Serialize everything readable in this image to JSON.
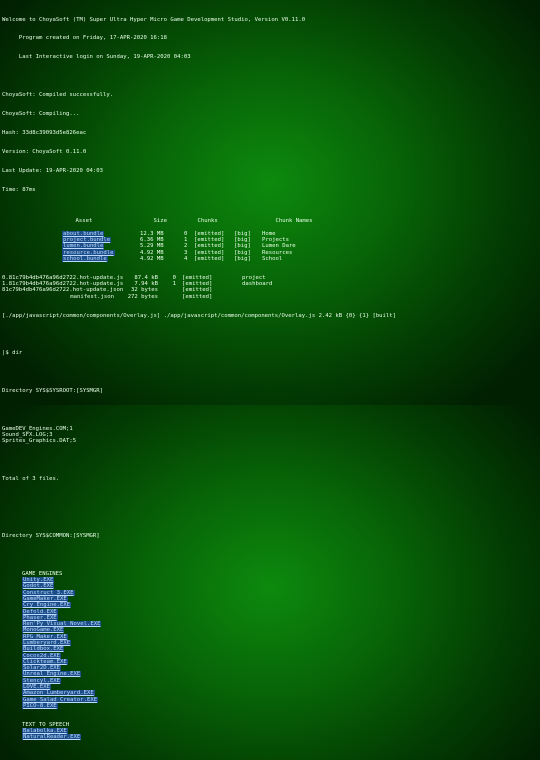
{
  "terminal": {
    "banner": [
      "Welcome to ChoyaSoft (TM) Super Ultra Hyper Micro Game Development Studio, Version V0.11.0",
      "     Program created on Friday, 17-APR-2020 16:18",
      "     Last Interactive login on Sunday, 19-APR-2020 04:03"
    ],
    "compile": [
      "ChoyaSoft: Compiled successfully.",
      "ChoyaSoft: Compiling...",
      "Hash: 33d8c39093d5e826eac",
      "Version: ChoyaSoft 0.11.0",
      "Last Update: 19-APR-2020 04:03",
      "Time: 87ms"
    ],
    "asset_headers": [
      "Asset",
      "Size",
      "Chunks",
      "",
      "",
      "Chunk Names"
    ],
    "assets": [
      {
        "name": "about.bundle",
        "size": "12.3 MB",
        "chunk": "0",
        "status": "[emitted]",
        "flag": "[big]",
        "chunk_name": "Home"
      },
      {
        "name": "project.bundle",
        "size": "6.36 MB",
        "chunk": "1",
        "status": "[emitted]",
        "flag": "[big]",
        "chunk_name": "Projects"
      },
      {
        "name": "lumen.bundle",
        "size": "5.29 MB",
        "chunk": "2",
        "status": "[emitted]",
        "flag": "[big]",
        "chunk_name": "Lumen Dare"
      },
      {
        "name": "resource.bundle",
        "size": "4.92 MB",
        "chunk": "3",
        "status": "[emitted]",
        "flag": "[big]",
        "chunk_name": "Resources"
      },
      {
        "name": "school.bundle",
        "size": "4.92 MB",
        "chunk": "4",
        "status": "[emitted]",
        "flag": "[big]",
        "chunk_name": "School"
      }
    ],
    "hot_updates": [
      {
        "file": "0.81c79b4db476a96d2722.hot-update.js",
        "size": "87.4 kB",
        "chunk": "0",
        "status": "[emitted]",
        "name": "project"
      },
      {
        "file": "1.81c79b4db476a96d2722.hot-update.js",
        "size": "7.94 kB",
        "chunk": "1",
        "status": "[emitted]",
        "name": "dashboard"
      },
      {
        "file": "81c79b4db476a96d2722.hot-update.json",
        "size": "32 bytes",
        "chunk": "",
        "status": "[emitted]",
        "name": ""
      },
      {
        "file": "manifest.json",
        "size": "272 bytes",
        "chunk": "",
        "status": "[emitted]",
        "name": ""
      }
    ],
    "overlay_line": "[./app/javascript/common/components/Overlay.js] ./app/javascript/common/components/Overlay.js 2.42 kB {0} {1} [built]",
    "cmd": "|$ dir",
    "dir_root": "Directory SYS$SYSROOT:[SYSMGR]",
    "root_files": [
      "GameDEV_Engines.COM;1",
      "Sound_SFX.LOG;3",
      "Sprites_Graphics.DAT;5"
    ],
    "total": "Total of 3 files.",
    "dir_common": "Directory SYS$COMMON:[SYSMGR]",
    "sections": [
      {
        "title": "GAME ENGINES",
        "items": [
          "Unity.EXE",
          "Godot.EXE",
          "Construct 3.EXE",
          "GameMaker.EXE",
          "Cry Engine.EXE",
          "Defold.EXE",
          "Phaser.EXE",
          "Ren'Py Visual Novel.EXE",
          "MonoGame.EXE",
          "RPG Maker.EXE",
          "Lumberyard.EXE",
          "Buildbox.EXE",
          "Cocos2d.EXE",
          "Clickteam.EXE",
          "Solar2D.EXE",
          "Unreal Engine.EXE",
          "Stencyl.EXE",
          "LOVE.EXE",
          "Amazon Lumberyard.EXE",
          "Game Salad Creator.EXE",
          "PICO-8.EXE"
        ]
      },
      {
        "title": "TEXT TO SPEECH",
        "items": [
          "Balabolka.EXE",
          "NaturalReader.EXE"
        ]
      }
    ]
  }
}
